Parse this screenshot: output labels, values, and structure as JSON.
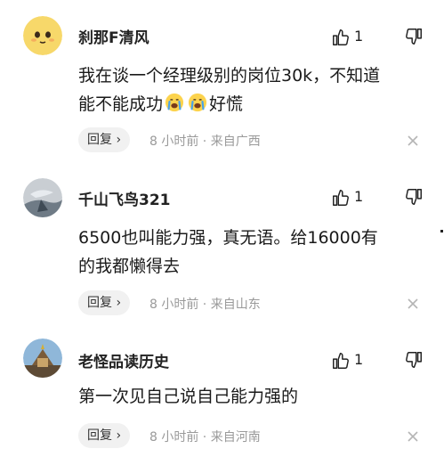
{
  "colors": {
    "meta_gray": "#9a9a9a",
    "reply_bg": "#f1f1f1",
    "text": "#222222"
  },
  "comments": [
    {
      "username": "刹那F清风",
      "likes": "1",
      "text_before": "我在谈一个经理级别的岗位30k，不知道\n能不能成功",
      "text_after": "好慌",
      "emoji_icons": [
        "crying-face-icon",
        "crying-face-icon"
      ],
      "reply_label": "回复",
      "meta": "8 小时前 · 来自广西",
      "avatar_icon": "yellow-face-avatar"
    },
    {
      "username": "千山飞鸟321",
      "likes": "1",
      "text": "6500也叫能力强，真无语。给16000有\n的我都懒得去",
      "reply_label": "回复",
      "meta": "8 小时前 · 来自山东",
      "avatar_icon": "photo-avatar"
    },
    {
      "username": "老怪品读历史",
      "likes": "1",
      "text": "第一次见自己说自己能力强的",
      "reply_label": "回复",
      "meta": "8 小时前 · 来自河南",
      "avatar_icon": "temple-photo-avatar"
    }
  ]
}
